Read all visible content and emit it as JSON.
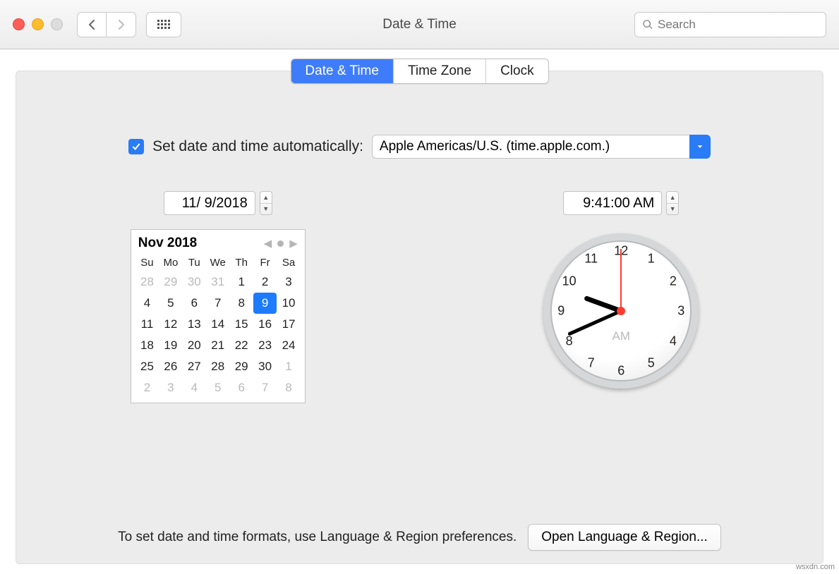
{
  "window": {
    "title": "Date & Time"
  },
  "search": {
    "placeholder": "Search"
  },
  "tabs": {
    "t0": "Date & Time",
    "t1": "Time Zone",
    "t2": "Clock"
  },
  "auto": {
    "label": "Set date and time automatically:",
    "server": "Apple Americas/U.S. (time.apple.com.)",
    "checked": true
  },
  "date_input": "11/ 9/2018",
  "time_input": "9:41:00 AM",
  "calendar": {
    "month_label": "Nov 2018",
    "dow": [
      "Su",
      "Mo",
      "Tu",
      "We",
      "Th",
      "Fr",
      "Sa"
    ],
    "weeks": [
      [
        {
          "n": 28,
          "out": true
        },
        {
          "n": 29,
          "out": true
        },
        {
          "n": 30,
          "out": true
        },
        {
          "n": 31,
          "out": true
        },
        {
          "n": 1
        },
        {
          "n": 2
        },
        {
          "n": 3
        }
      ],
      [
        {
          "n": 4
        },
        {
          "n": 5
        },
        {
          "n": 6
        },
        {
          "n": 7
        },
        {
          "n": 8
        },
        {
          "n": 9,
          "sel": true
        },
        {
          "n": 10
        }
      ],
      [
        {
          "n": 11
        },
        {
          "n": 12
        },
        {
          "n": 13
        },
        {
          "n": 14
        },
        {
          "n": 15
        },
        {
          "n": 16
        },
        {
          "n": 17
        }
      ],
      [
        {
          "n": 18
        },
        {
          "n": 19
        },
        {
          "n": 20
        },
        {
          "n": 21
        },
        {
          "n": 22
        },
        {
          "n": 23
        },
        {
          "n": 24
        }
      ],
      [
        {
          "n": 25
        },
        {
          "n": 26
        },
        {
          "n": 27
        },
        {
          "n": 28
        },
        {
          "n": 29
        },
        {
          "n": 30
        },
        {
          "n": 1,
          "out": true
        }
      ],
      [
        {
          "n": 2,
          "out": true
        },
        {
          "n": 3,
          "out": true
        },
        {
          "n": 4,
          "out": true
        },
        {
          "n": 5,
          "out": true
        },
        {
          "n": 6,
          "out": true
        },
        {
          "n": 7,
          "out": true
        },
        {
          "n": 8,
          "out": true
        }
      ]
    ]
  },
  "clock": {
    "ampm": "AM",
    "numbers": [
      "12",
      "1",
      "2",
      "3",
      "4",
      "5",
      "6",
      "7",
      "8",
      "9",
      "10",
      "11"
    ]
  },
  "footer": {
    "text": "To set date and time formats, use Language & Region preferences.",
    "button": "Open Language & Region..."
  },
  "watermark": "wsxdn.com"
}
